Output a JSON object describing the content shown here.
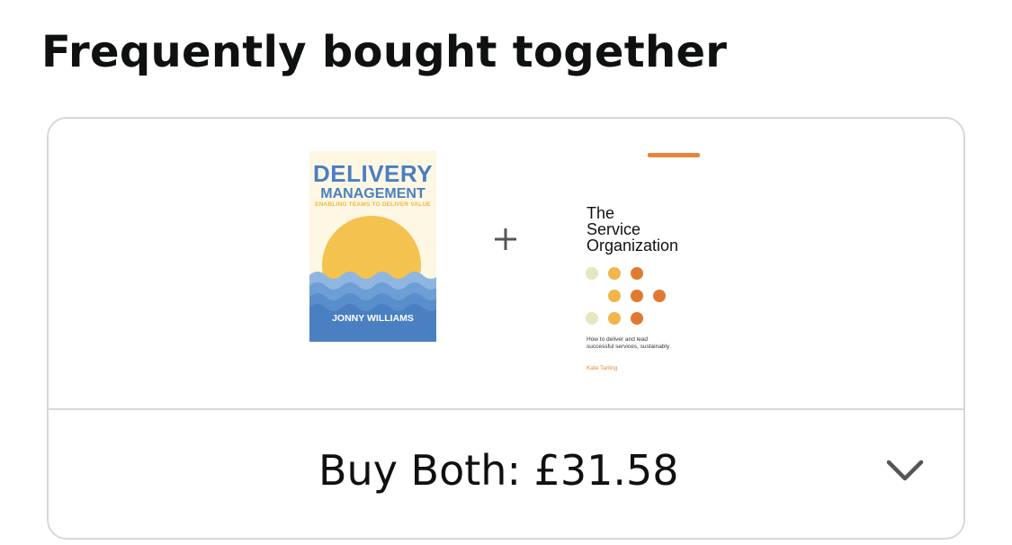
{
  "heading": "Frequently bought together",
  "products": [
    {
      "title_line1": "DELIVERY",
      "title_line2": "MANAGEMENT",
      "subtitle": "ENABLING TEAMS TO DELIVER VALUE",
      "author": "JONNY WILLIAMS",
      "colors": {
        "background": "#fdf7e4",
        "title": "#4a7fc1",
        "sun": "#f4c24e",
        "water": "#4a7fc1"
      }
    },
    {
      "title_line1": "The",
      "title_line2": "Service",
      "title_line3": "Organization",
      "description_line1": "How to deliver and lead",
      "description_line2": "successful services, sustainably",
      "author": "Kate Tarling",
      "colors": {
        "accent": "#e9853a",
        "dot_light": "#e8e6c0",
        "dot_mid": "#f0b64a",
        "dot_dark": "#e07a32"
      }
    }
  ],
  "plus_icon": "plus-icon",
  "buy": {
    "label": "Buy Both: £31.58",
    "expand_icon": "chevron-down-icon"
  },
  "colors": {
    "border": "#d5d9d9",
    "text": "#0f1111",
    "icon": "#555555"
  }
}
